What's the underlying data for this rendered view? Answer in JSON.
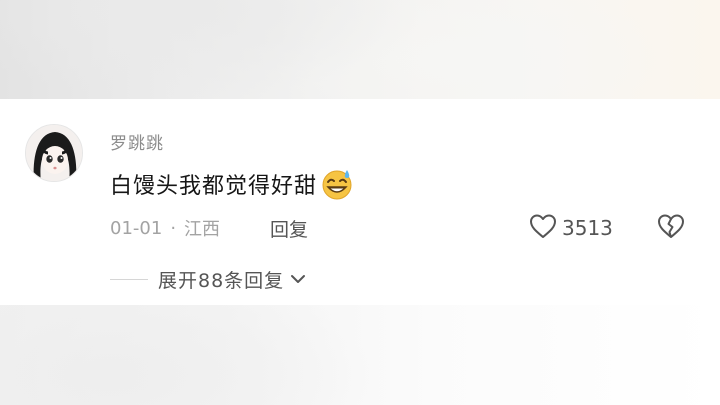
{
  "comment": {
    "username": "罗跳跳",
    "text": "白馒头我都觉得好甜",
    "emoji": "grinning-sweat-emoji",
    "date": "01-01",
    "separator": "·",
    "location": "江西",
    "reply_label": "回复",
    "like_count": "3513",
    "expand_replies_label": "展开88条回复"
  },
  "icons": {
    "like": "heart-outline-icon",
    "dislike": "broken-heart-icon",
    "expand": "chevron-down-icon"
  },
  "colors": {
    "username": "#8c8c8c",
    "text": "#161616",
    "meta": "#a3a3a3",
    "action": "#555555"
  }
}
